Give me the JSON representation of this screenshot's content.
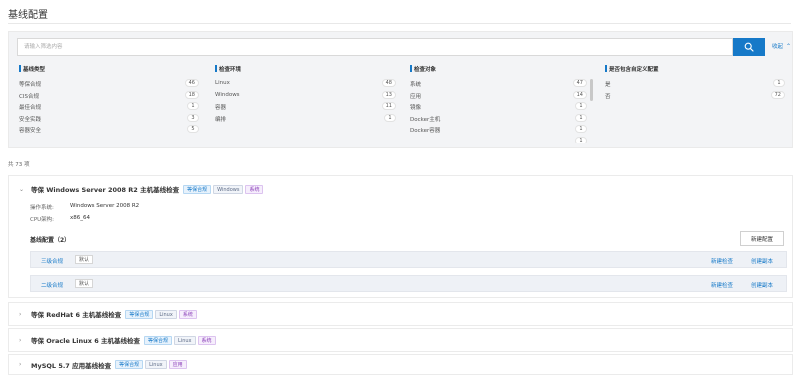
{
  "page": {
    "title": "基线配置"
  },
  "search": {
    "placeholder": "请输入筛选内容",
    "value": "",
    "collapse_label": "收起"
  },
  "facets": [
    {
      "title": "基线类型",
      "items": [
        {
          "label": "等保合规",
          "count": "46"
        },
        {
          "label": "CIS合规",
          "count": "18"
        },
        {
          "label": "最佳合规",
          "count": "1"
        },
        {
          "label": "安全实践",
          "count": "3"
        },
        {
          "label": "容器安全",
          "count": "5"
        }
      ]
    },
    {
      "title": "检查环境",
      "items": [
        {
          "label": "Linux",
          "count": "48"
        },
        {
          "label": "Windows",
          "count": "13"
        },
        {
          "label": "容器",
          "count": "11"
        },
        {
          "label": "编排",
          "count": "1"
        }
      ]
    },
    {
      "title": "检查对象",
      "items": [
        {
          "label": "系统",
          "count": "47"
        },
        {
          "label": "应用",
          "count": "14"
        },
        {
          "label": "镜像",
          "count": "1"
        },
        {
          "label": "Docker主机",
          "count": "1"
        },
        {
          "label": "Docker容器",
          "count": "1"
        },
        {
          "label": "",
          "count": "1"
        }
      ]
    },
    {
      "title": "是否包含自定义配置",
      "items": [
        {
          "label": "是",
          "count": "1"
        },
        {
          "label": "否",
          "count": "72"
        }
      ]
    }
  ],
  "results": {
    "count_label": "共 73 项"
  },
  "rules": [
    {
      "name": "等保 Windows Server 2008 R2 主机基线检查",
      "tags": [
        "等保合规",
        "Windows",
        "系统"
      ],
      "expanded": true,
      "os_label": "操作系统:",
      "os_value": "Windows Server 2008 R2",
      "cpu_label": "CPU架构:",
      "cpu_value": "x86_64",
      "subconfig_title": "基线配置（2）",
      "new_config_label": "新建配置",
      "subconfigs": [
        {
          "name": "三级合规",
          "default_label": "默认",
          "action1": "新建检查",
          "action2": "创建副本"
        },
        {
          "name": "二级合规",
          "default_label": "默认",
          "action1": "新建检查",
          "action2": "创建副本"
        }
      ]
    },
    {
      "name": "等保 RedHat 6 主机基线检查",
      "tags": [
        "等保合规",
        "Linux",
        "系统"
      ]
    },
    {
      "name": "等保 Oracle Linux 6 主机基线检查",
      "tags": [
        "等保合规",
        "Linux",
        "系统"
      ]
    },
    {
      "name": "MySQL 5.7 应用基线检查",
      "tags": [
        "等保合规",
        "Linux",
        "应用"
      ]
    }
  ],
  "colors": {
    "accent": "#1679c8",
    "panel_bg": "#f3f4f6",
    "tag_purple": "#8a3fb8"
  }
}
